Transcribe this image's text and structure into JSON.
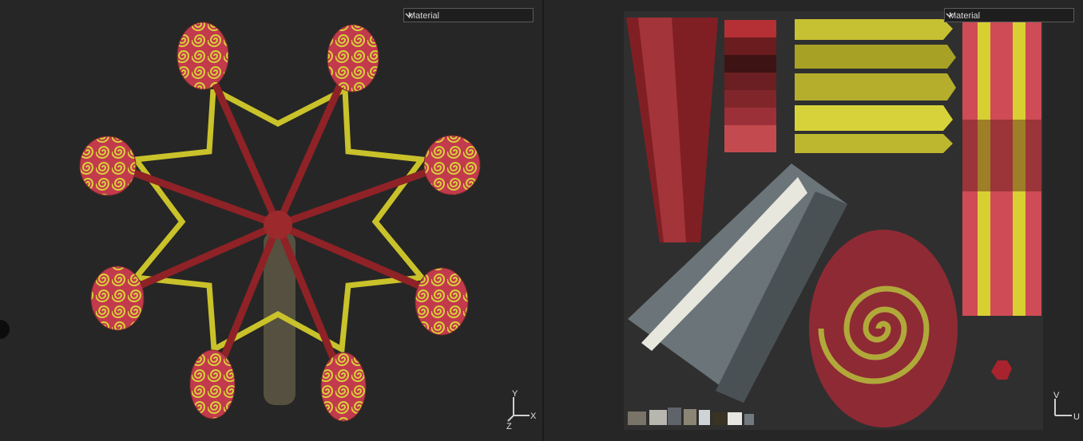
{
  "viewport_3d": {
    "material_select": {
      "value": "Material"
    },
    "gizmo": {
      "y": "Y",
      "x": "X",
      "z": "Z"
    }
  },
  "viewport_uv": {
    "material_select": {
      "value": "Material"
    },
    "gizmo": {
      "v": "V",
      "u": "U"
    }
  },
  "colors": {
    "background": "#262626",
    "frame_red": "#8e2226",
    "frame_yellow": "#c9c22a",
    "cabin_red": "#c0384a",
    "uv_canvas": "#2f2f2f"
  },
  "icons": [
    "chevron-down-icon",
    "axis-gizmo-icon"
  ]
}
